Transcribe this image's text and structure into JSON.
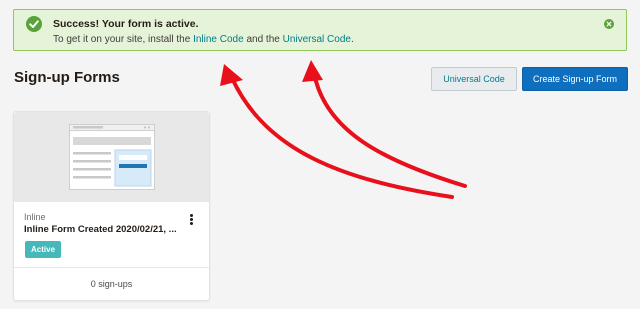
{
  "banner": {
    "title": "Success! Your form is active.",
    "body_prefix": "To get it on your site, install the ",
    "link_inline": "Inline Code",
    "body_middle": " and the ",
    "link_universal": "Universal Code",
    "body_suffix": ".",
    "success_color": "#5aa33b"
  },
  "header": {
    "title": "Sign-up Forms",
    "universal_button": "Universal Code",
    "create_button": "Create Sign-up Form"
  },
  "forms": [
    {
      "type": "Inline",
      "name": "Inline Form Created 2020/02/21, ...",
      "status": "Active",
      "signups": "0 sign-ups"
    }
  ],
  "colors": {
    "accent": "#007c89",
    "primary": "#0f6fbf",
    "badge": "#45b8b9",
    "annotation": "#e8101a"
  }
}
